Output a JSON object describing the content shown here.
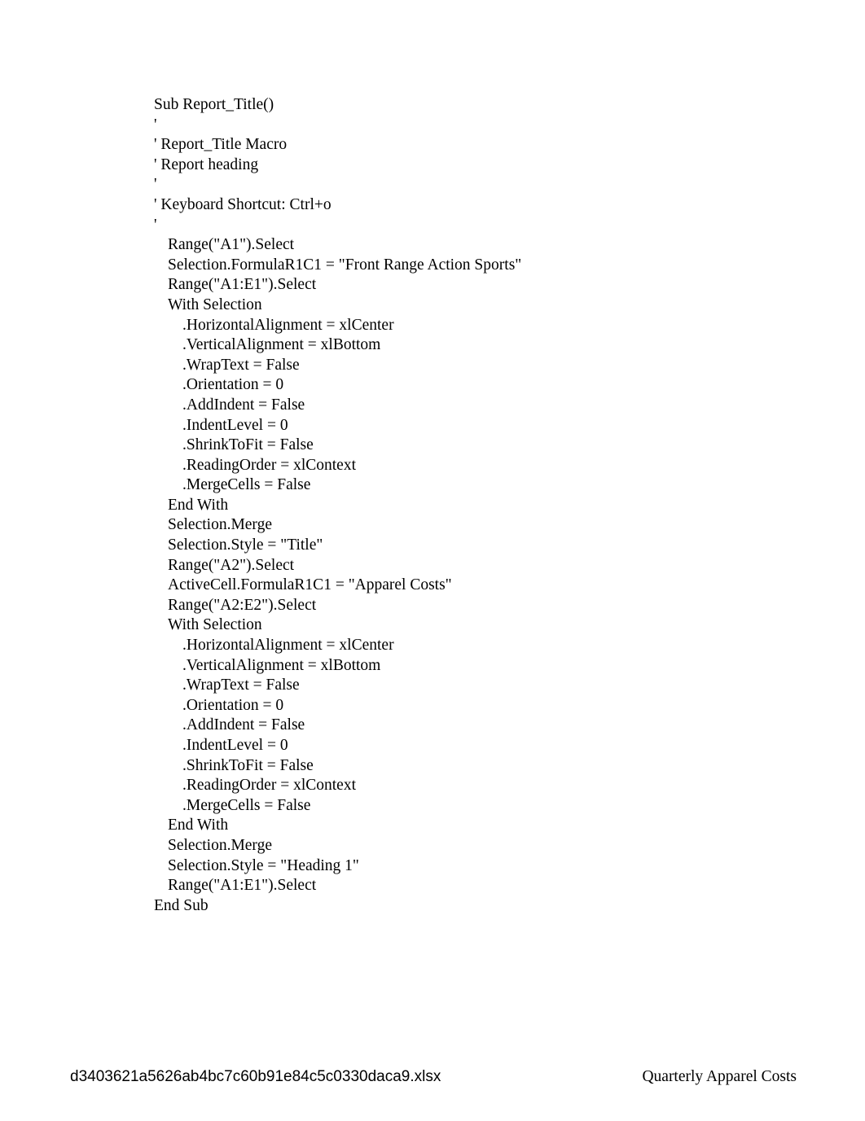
{
  "document": {
    "body_lines": [
      {
        "text": "Sub Report_Title()",
        "indent": 0
      },
      {
        "text": "'",
        "indent": 0
      },
      {
        "text": "' Report_Title Macro",
        "indent": 0
      },
      {
        "text": "' Report heading",
        "indent": 0
      },
      {
        "text": "'",
        "indent": 0
      },
      {
        "text": "' Keyboard Shortcut: Ctrl+o",
        "indent": 0
      },
      {
        "text": "'",
        "indent": 0
      },
      {
        "text": "Range(\"A1\").Select",
        "indent": 1
      },
      {
        "text": "Selection.FormulaR1C1 = \"Front Range Action Sports\"",
        "indent": 1
      },
      {
        "text": "Range(\"A1:E1\").Select",
        "indent": 1
      },
      {
        "text": "With Selection",
        "indent": 1
      },
      {
        "text": ".HorizontalAlignment = xlCenter",
        "indent": 2
      },
      {
        "text": ".VerticalAlignment = xlBottom",
        "indent": 2
      },
      {
        "text": ".WrapText = False",
        "indent": 2
      },
      {
        "text": ".Orientation = 0",
        "indent": 2
      },
      {
        "text": ".AddIndent = False",
        "indent": 2
      },
      {
        "text": ".IndentLevel = 0",
        "indent": 2
      },
      {
        "text": ".ShrinkToFit = False",
        "indent": 2
      },
      {
        "text": ".ReadingOrder = xlContext",
        "indent": 2
      },
      {
        "text": ".MergeCells = False",
        "indent": 2
      },
      {
        "text": "End With",
        "indent": 1
      },
      {
        "text": "Selection.Merge",
        "indent": 1
      },
      {
        "text": "Selection.Style = \"Title\"",
        "indent": 1
      },
      {
        "text": "Range(\"A2\").Select",
        "indent": 1
      },
      {
        "text": "ActiveCell.FormulaR1C1 = \"Apparel Costs\"",
        "indent": 1
      },
      {
        "text": "Range(\"A2:E2\").Select",
        "indent": 1
      },
      {
        "text": "With Selection",
        "indent": 1
      },
      {
        "text": ".HorizontalAlignment = xlCenter",
        "indent": 2
      },
      {
        "text": ".VerticalAlignment = xlBottom",
        "indent": 2
      },
      {
        "text": ".WrapText = False",
        "indent": 2
      },
      {
        "text": ".Orientation = 0",
        "indent": 2
      },
      {
        "text": ".AddIndent = False",
        "indent": 2
      },
      {
        "text": ".IndentLevel = 0",
        "indent": 2
      },
      {
        "text": ".ShrinkToFit = False",
        "indent": 2
      },
      {
        "text": ".ReadingOrder = xlContext",
        "indent": 2
      },
      {
        "text": ".MergeCells = False",
        "indent": 2
      },
      {
        "text": "End With",
        "indent": 1
      },
      {
        "text": "Selection.Merge",
        "indent": 1
      },
      {
        "text": "Selection.Style = \"Heading 1\"",
        "indent": 1
      },
      {
        "text": "Range(\"A1:E1\").Select",
        "indent": 1
      },
      {
        "text": "End Sub",
        "indent": 0
      }
    ],
    "footer": {
      "left": "d3403621a5626ab4bc7c60b91e84c5c0330daca9.xlsx",
      "right": "Quarterly Apparel Costs"
    }
  }
}
